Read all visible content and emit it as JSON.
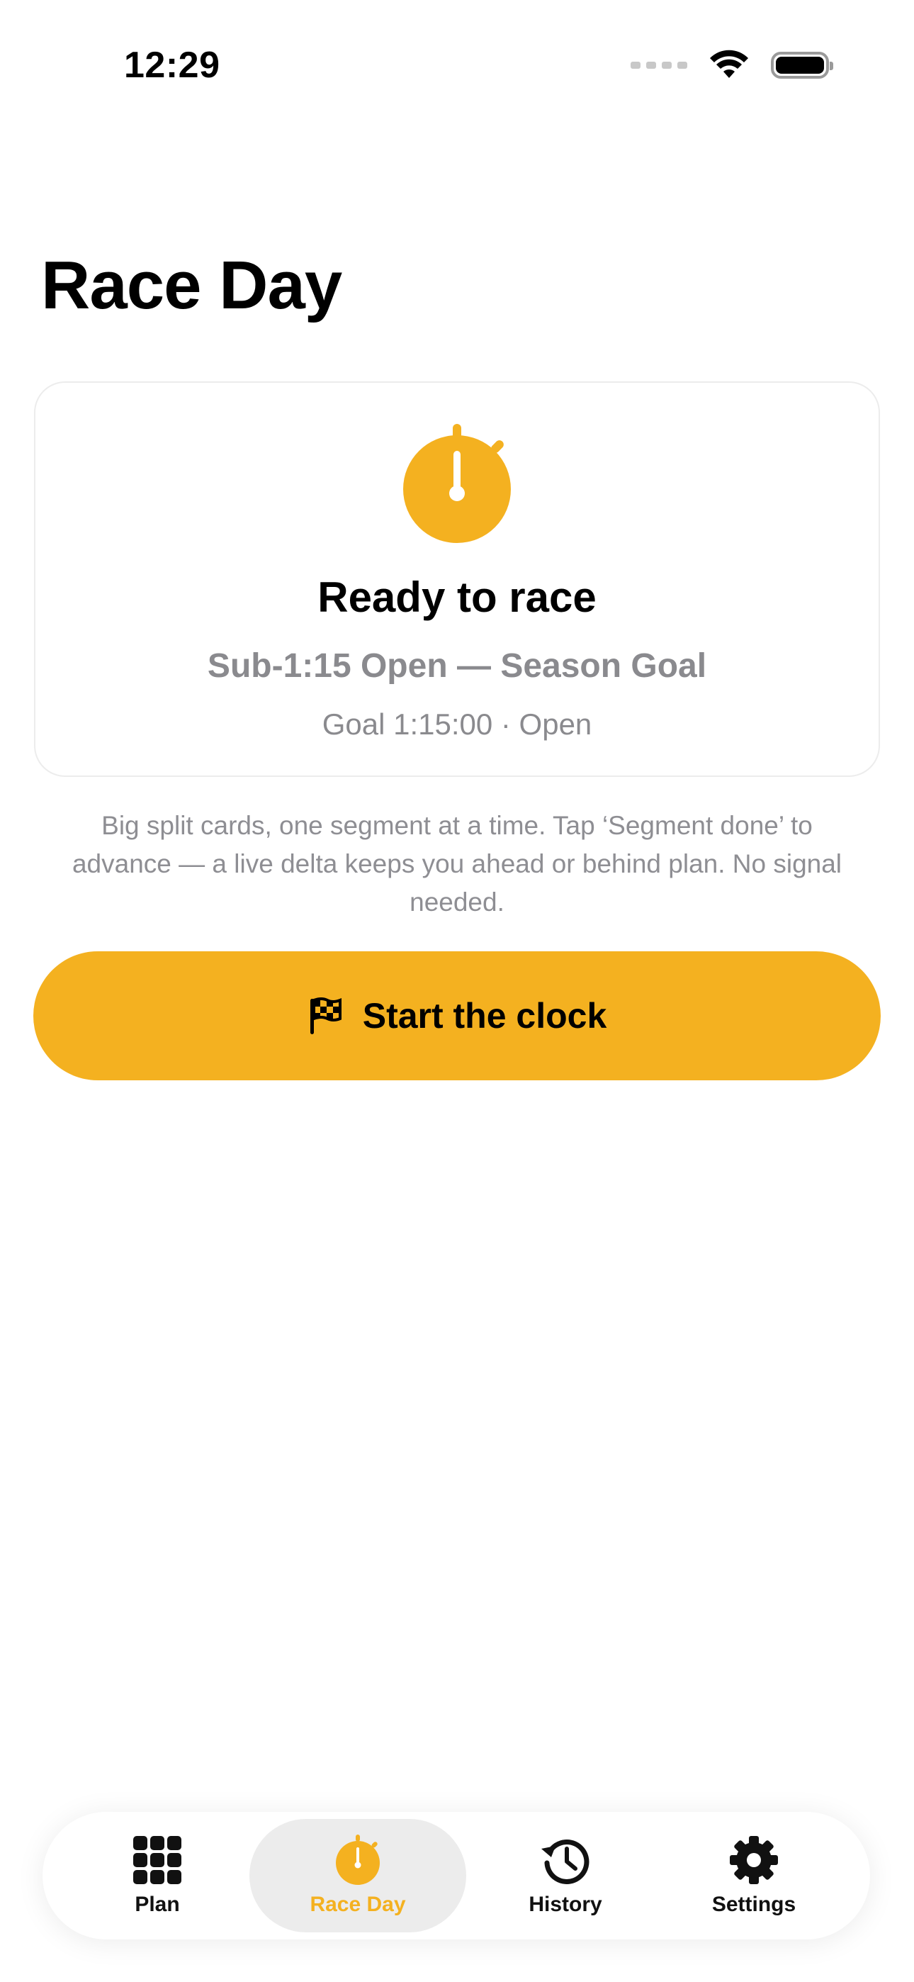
{
  "status": {
    "time": "12:29"
  },
  "page": {
    "title": "Race Day"
  },
  "card": {
    "icon": "stopwatch-icon",
    "title": "Ready to race",
    "subtitle": "Sub-1:15 Open — Season Goal",
    "meta": "Goal 1:15:00 · Open"
  },
  "description": "Big split cards, one segment at a time. Tap ‘Segment done’ to advance — a live delta keeps you ahead or behind plan. No signal needed.",
  "start_button": {
    "icon": "checkered-flag-icon",
    "label": "Start the clock"
  },
  "tabs": [
    {
      "label": "Plan",
      "icon": "grid-icon"
    },
    {
      "label": "Race Day",
      "icon": "stopwatch-icon"
    },
    {
      "label": "History",
      "icon": "history-icon"
    },
    {
      "label": "Settings",
      "icon": "gear-icon"
    }
  ],
  "colors": {
    "accent": "#f4b120",
    "secondary_text": "#8a8a8e"
  }
}
